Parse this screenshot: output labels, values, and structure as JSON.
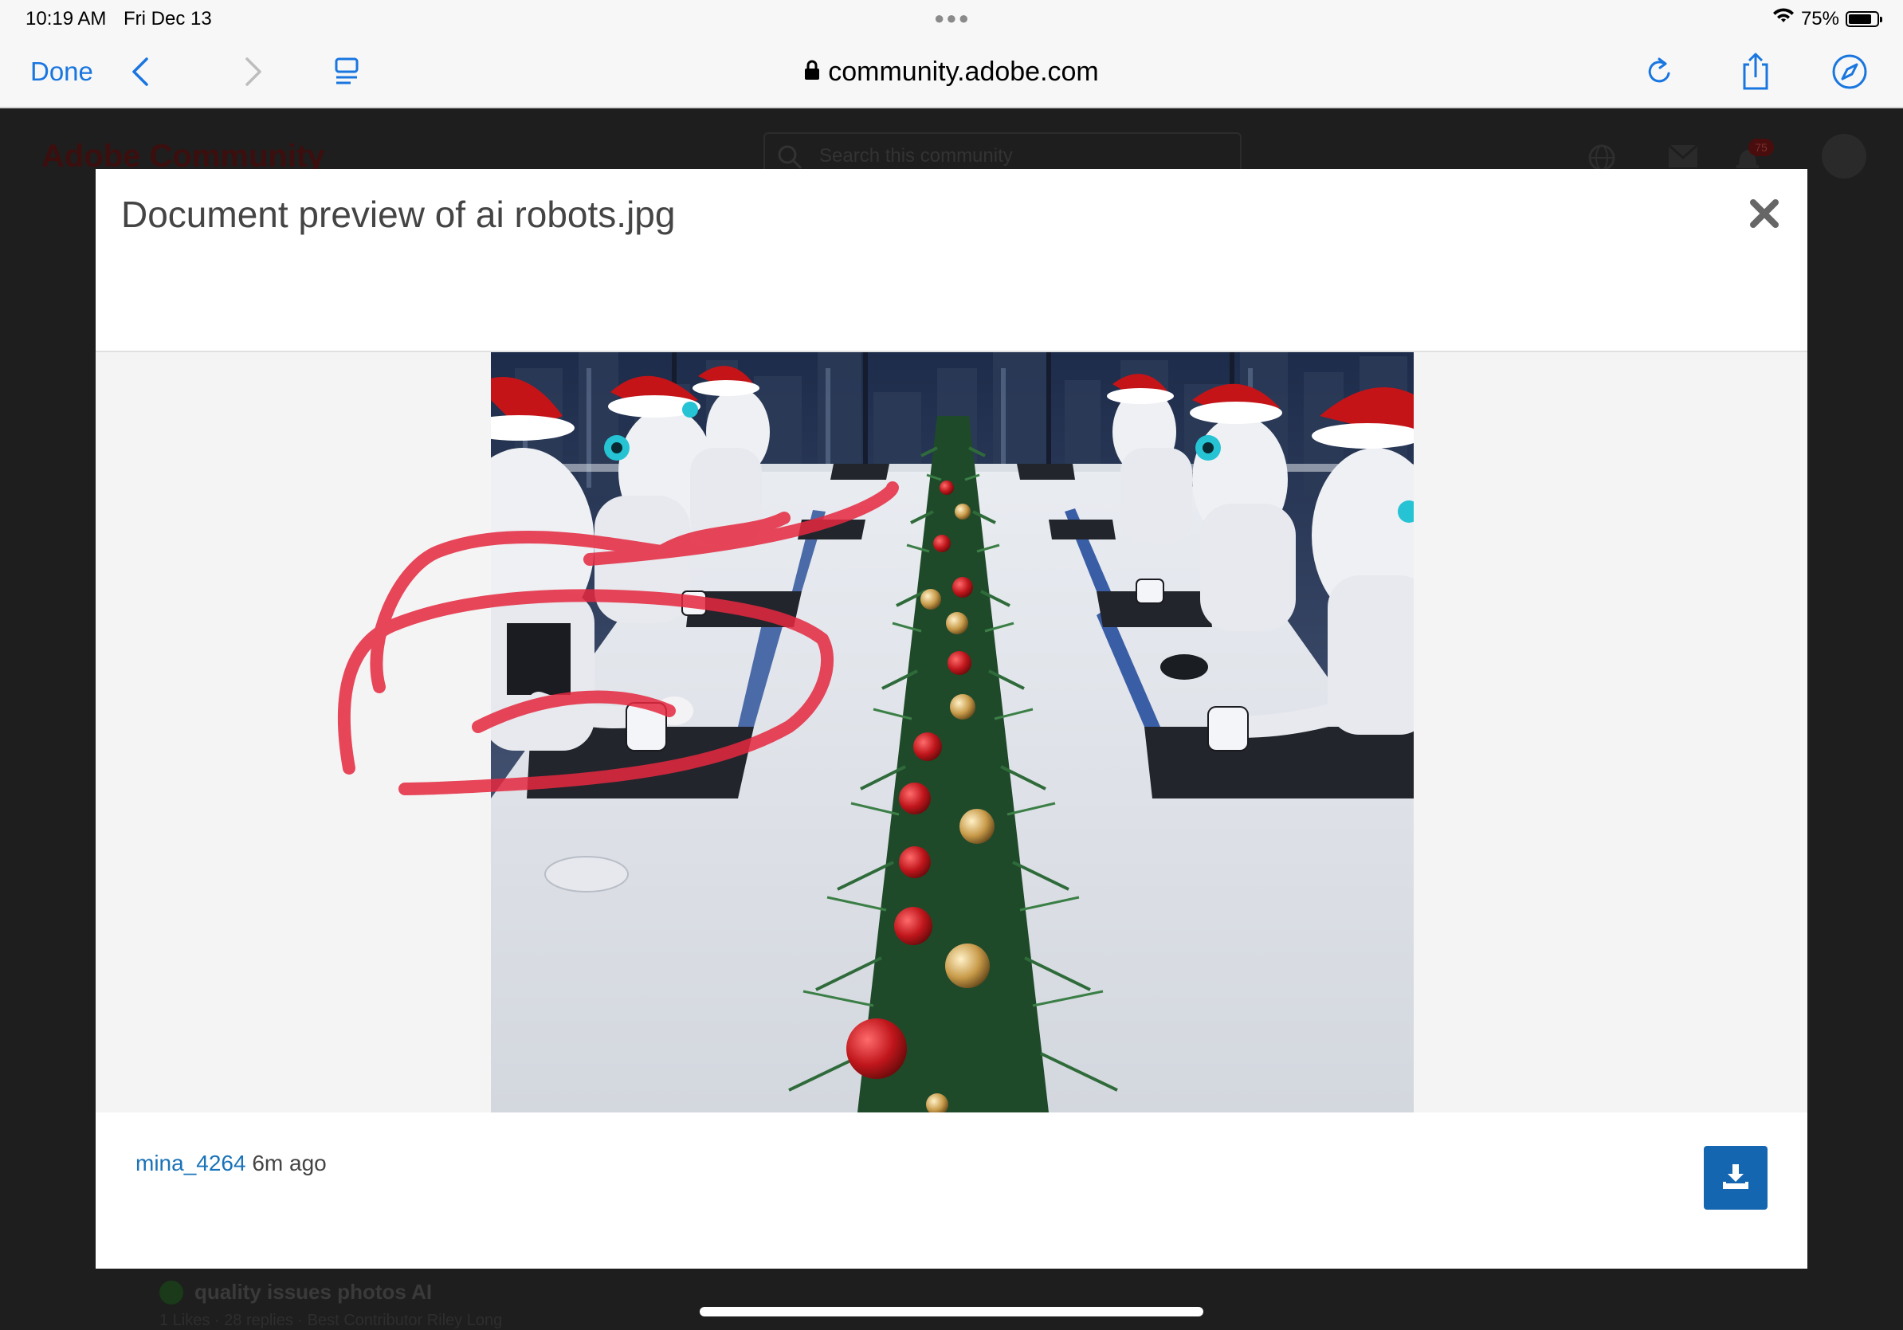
{
  "status_bar": {
    "time": "10:19 AM",
    "date": "Fri Dec 13",
    "battery": "75%",
    "battery_level": 0.75
  },
  "browser": {
    "done_label": "Done",
    "url": "community.adobe.com",
    "icons": [
      "back-icon",
      "forward-icon",
      "reader-icon",
      "reload-icon",
      "share-icon",
      "compass-icon",
      "lock-icon",
      "wifi-icon"
    ]
  },
  "background_page": {
    "logo": "Adobe Community",
    "search_placeholder": "Search this community",
    "notification_count": "75",
    "post_title": "quality issues photos AI",
    "post_meta": "1 Likes · 28 replies · Best Contributor Riley Long"
  },
  "modal": {
    "title": "Document preview of ai robots.jpg",
    "author": "mina_4264",
    "time_ago": "6m ago",
    "close_icon": "close-icon",
    "download_icon": "download-icon",
    "accent_color": "#1466b0"
  }
}
